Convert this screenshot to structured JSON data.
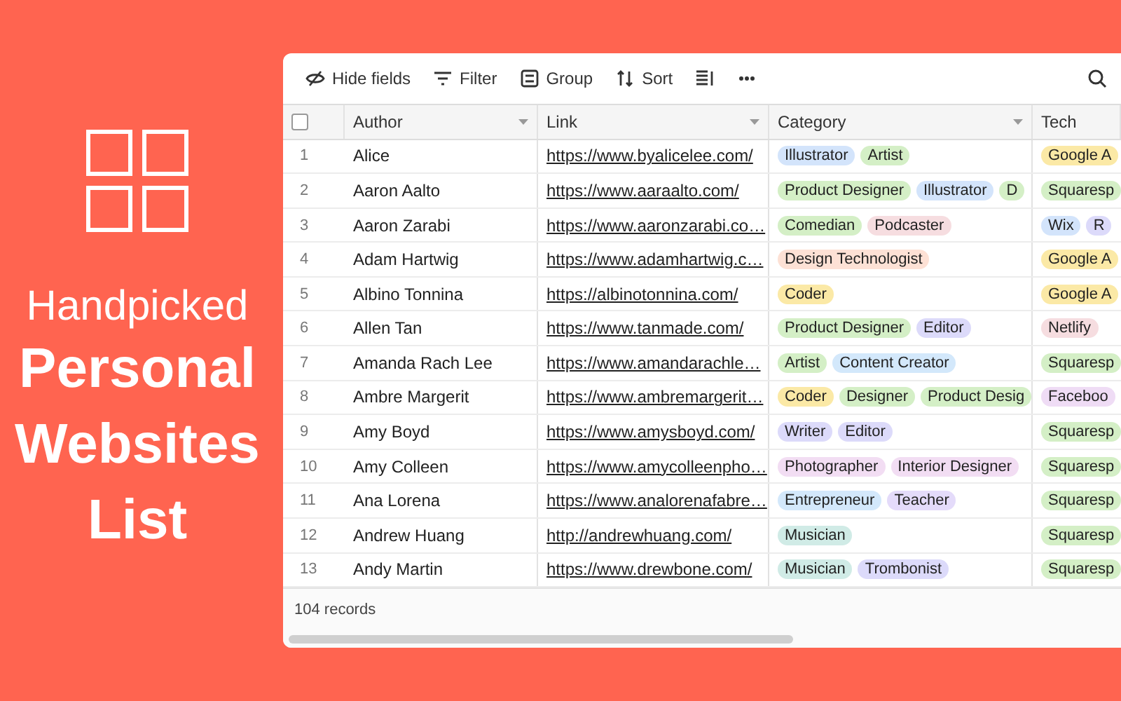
{
  "branding": {
    "eyebrow": "Handpicked",
    "title": "Personal Websites List"
  },
  "toolbar": [
    {
      "kind": "hide",
      "label": "Hide fields"
    },
    {
      "kind": "filter",
      "label": "Filter"
    },
    {
      "kind": "group",
      "label": "Group"
    },
    {
      "kind": "sort",
      "label": "Sort"
    },
    {
      "kind": "rowheight"
    },
    {
      "kind": "more"
    }
  ],
  "table": {
    "select_all": {
      "checked": false
    },
    "columns": [
      {
        "label": "Author",
        "menu": true
      },
      {
        "label": "Link",
        "menu": true
      },
      {
        "label": "Category",
        "menu": true
      },
      {
        "label": "Tech",
        "menu": false
      }
    ],
    "rows": [
      {
        "number": "1",
        "author": "Alice",
        "link": "https://www.byalicelee.com/",
        "category": [
          {
            "label": "Illustrator",
            "color": "#d3e4fb"
          },
          {
            "label": "Artist",
            "color": "#d4efc6"
          }
        ],
        "tech": [
          {
            "label": "Google A",
            "color": "#fbe9a6"
          }
        ]
      },
      {
        "number": "2",
        "author": "Aaron Aalto",
        "link": "https://www.aaraalto.com/",
        "category": [
          {
            "label": "Product Designer",
            "color": "#d4efc6"
          },
          {
            "label": "Illustrator",
            "color": "#d3e4fb"
          },
          {
            "label": "D",
            "color": "#d4efc6"
          }
        ],
        "tech": [
          {
            "label": "Squaresp",
            "color": "#d4efc6"
          }
        ]
      },
      {
        "number": "3",
        "author": "Aaron Zarabi",
        "link": "https://www.aaronzarabi.co…",
        "category": [
          {
            "label": "Comedian",
            "color": "#d4efc6"
          },
          {
            "label": "Podcaster",
            "color": "#f6dde0"
          }
        ],
        "tech": [
          {
            "label": "Wix",
            "color": "#d3e4fb"
          },
          {
            "label": "R",
            "color": "#dcdafa"
          }
        ]
      },
      {
        "number": "4",
        "author": "Adam Hartwig",
        "link": "https://www.adamhartwig.c…",
        "category": [
          {
            "label": "Design Technologist",
            "color": "#fde1d5"
          }
        ],
        "tech": [
          {
            "label": "Google A",
            "color": "#fbe9a6"
          }
        ]
      },
      {
        "number": "5",
        "author": "Albino Tonnina",
        "link": "https://albinotonnina.com/",
        "category": [
          {
            "label": "Coder",
            "color": "#fbe9a6"
          }
        ],
        "tech": [
          {
            "label": "Google A",
            "color": "#fbe9a6"
          }
        ]
      },
      {
        "number": "6",
        "author": "Allen Tan",
        "link": "https://www.tanmade.com/",
        "category": [
          {
            "label": "Product Designer",
            "color": "#d4efc6"
          },
          {
            "label": "Editor",
            "color": "#dcdafa"
          }
        ],
        "tech": [
          {
            "label": "Netlify",
            "color": "#f6dde0"
          }
        ]
      },
      {
        "number": "7",
        "author": "Amanda Rach Lee",
        "link": "https://www.amandarachle…",
        "category": [
          {
            "label": "Artist",
            "color": "#d4efc6"
          },
          {
            "label": "Content Creator",
            "color": "#d3e8fb"
          }
        ],
        "tech": [
          {
            "label": "Squaresp",
            "color": "#d4efc6"
          }
        ]
      },
      {
        "number": "8",
        "author": "Ambre Margerit",
        "link": "https://www.ambremargerit…",
        "category": [
          {
            "label": "Coder",
            "color": "#fbe9a6"
          },
          {
            "label": "Designer",
            "color": "#d4efc6"
          },
          {
            "label": "Product Desig",
            "color": "#d4efc6"
          }
        ],
        "tech": [
          {
            "label": "Faceboo",
            "color": "#efdcf5"
          }
        ]
      },
      {
        "number": "9",
        "author": "Amy Boyd",
        "link": "https://www.amysboyd.com/",
        "category": [
          {
            "label": "Writer",
            "color": "#dcdafa"
          },
          {
            "label": "Editor",
            "color": "#dcdafa"
          }
        ],
        "tech": [
          {
            "label": "Squaresp",
            "color": "#d4efc6"
          }
        ]
      },
      {
        "number": "10",
        "author": "Amy Colleen",
        "link": "https://www.amycolleenpho…",
        "category": [
          {
            "label": "Photographer",
            "color": "#f2ddf3"
          },
          {
            "label": "Interior Designer",
            "color": "#f2ddf3"
          }
        ],
        "tech": [
          {
            "label": "Squaresp",
            "color": "#d4efc6"
          }
        ]
      },
      {
        "number": "11",
        "author": "Ana Lorena",
        "link": "https://www.analorenafabre…",
        "category": [
          {
            "label": "Entrepreneur",
            "color": "#d3e8fb"
          },
          {
            "label": "Teacher",
            "color": "#e4dbfa"
          }
        ],
        "tech": [
          {
            "label": "Squaresp",
            "color": "#d4efc6"
          }
        ]
      },
      {
        "number": "12",
        "author": "Andrew Huang",
        "link": "http://andrewhuang.com/",
        "category": [
          {
            "label": "Musician",
            "color": "#d0ebe6"
          }
        ],
        "tech": [
          {
            "label": "Squaresp",
            "color": "#d4efc6"
          }
        ]
      },
      {
        "number": "13",
        "author": "Andy Martin",
        "link": "https://www.drewbone.com/",
        "category": [
          {
            "label": "Musician",
            "color": "#d0ebe6"
          },
          {
            "label": "Trombonist",
            "color": "#dcdafa"
          }
        ],
        "tech": [
          {
            "label": "Squaresp",
            "color": "#d4efc6"
          }
        ]
      }
    ],
    "footer": "104 records"
  }
}
